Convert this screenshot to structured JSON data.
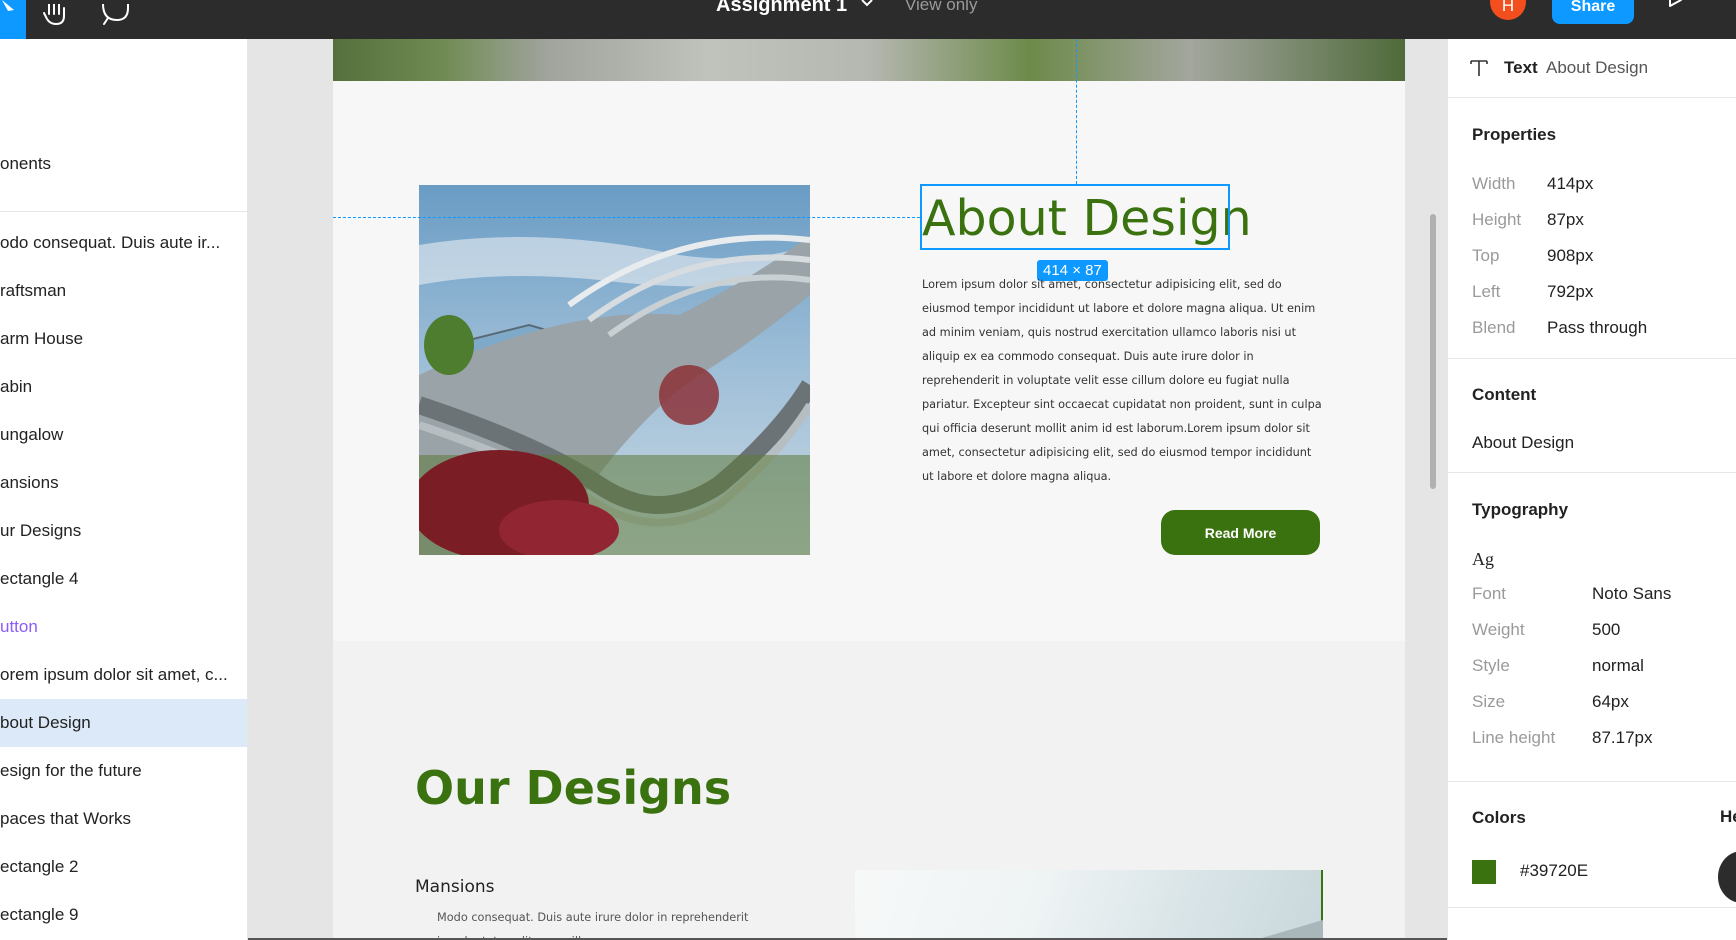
{
  "topbar": {
    "title": "Assignment 1",
    "view_mode": "View only",
    "avatar_initial": "H",
    "share_label": "Share"
  },
  "layers": {
    "header": "onents",
    "items": [
      {
        "label": "odo consequat. Duis aute ir...",
        "type": "text"
      },
      {
        "label": "raftsman",
        "type": "text"
      },
      {
        "label": "arm House",
        "type": "text"
      },
      {
        "label": "abin",
        "type": "text"
      },
      {
        "label": "ungalow",
        "type": "text"
      },
      {
        "label": "ansions",
        "type": "text"
      },
      {
        "label": "ur Designs",
        "type": "text"
      },
      {
        "label": "ectangle 4",
        "type": "rect"
      },
      {
        "label": "utton",
        "type": "component"
      },
      {
        "label": "orem ipsum dolor sit amet, c...",
        "type": "text"
      },
      {
        "label": "bout Design",
        "type": "text",
        "selected": true
      },
      {
        "label": "esign for the future",
        "type": "text"
      },
      {
        "label": "paces that Works",
        "type": "text"
      },
      {
        "label": "ectangle 2",
        "type": "rect"
      },
      {
        "label": "ectangle 9",
        "type": "rect"
      }
    ]
  },
  "canvas": {
    "about_title": "About Design",
    "selection_size": "414 × 87",
    "about_body": "Lorem ipsum dolor sit amet, consectetur adipisicing elit, sed do eiusmod tempor incididunt ut labore et dolore magna aliqua. Ut enim ad minim veniam, quis nostrud exercitation ullamco laboris nisi ut aliquip ex ea commodo consequat. Duis aute irure dolor in reprehenderit in voluptate velit esse cillum dolore eu fugiat nulla pariatur. Excepteur sint occaecat cupidatat non proident, sunt in culpa qui officia deserunt mollit anim id est laborum.Lorem ipsum dolor sit amet, consectetur adipisicing elit, sed do eiusmod tempor incididunt ut labore et dolore magna aliqua.",
    "read_more_label": "Read More",
    "designs_title": "Our Designs",
    "mansions_title": "Mansions",
    "mansions_desc": "Modo consequat. Duis aute irure dolor in reprehenderit in voluptate velit esse cillum"
  },
  "inspector": {
    "node_type": "Text",
    "node_name": "About Design",
    "properties_title": "Properties",
    "properties": [
      {
        "label": "Width",
        "value": "414px"
      },
      {
        "label": "Height",
        "value": "87px"
      },
      {
        "label": "Top",
        "value": "908px"
      },
      {
        "label": "Left",
        "value": "792px"
      },
      {
        "label": "Blend",
        "value": "Pass through"
      }
    ],
    "content_title": "Content",
    "content_value": "About Design",
    "typography_title": "Typography",
    "typography_sample": "Ag",
    "typography": [
      {
        "label": "Font",
        "value": "Noto Sans"
      },
      {
        "label": "Weight",
        "value": "500"
      },
      {
        "label": "Style",
        "value": "normal"
      },
      {
        "label": "Size",
        "value": "64px"
      },
      {
        "label": "Line height",
        "value": "87.17px"
      }
    ],
    "colors_title": "Colors",
    "colors_side_label": "He",
    "color_hex": "#39720E"
  },
  "colors": {
    "brand_green": "#39720e",
    "figma_blue": "#0d99ff",
    "dark_bar": "#2c2c2c"
  }
}
